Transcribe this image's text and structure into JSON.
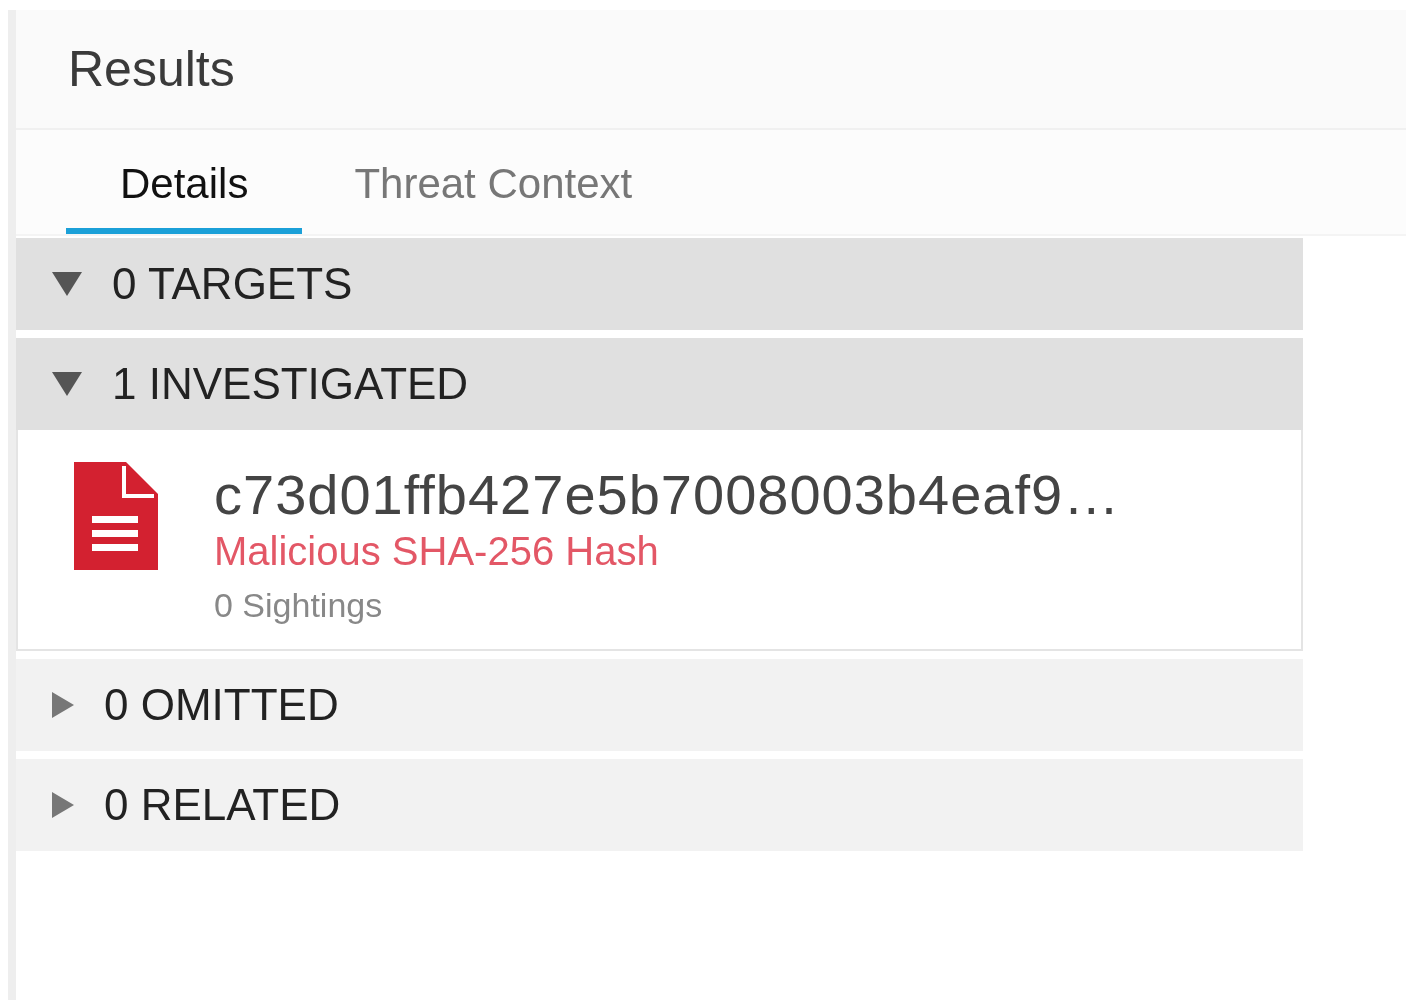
{
  "panel": {
    "title": "Results"
  },
  "tabs": [
    {
      "label": "Details",
      "selected": true
    },
    {
      "label": "Threat Context",
      "selected": false
    }
  ],
  "sections": [
    {
      "label": "0 TARGETS",
      "expanded": true
    },
    {
      "label": "1 INVESTIGATED",
      "expanded": true,
      "items": [
        {
          "hash": "c73d01ffb427e5b7008003b4eaf9…",
          "verdict": "Malicious SHA-256 Hash",
          "sightings": "0 Sightings"
        }
      ]
    },
    {
      "label": "0 OMITTED",
      "expanded": false
    },
    {
      "label": "0 RELATED",
      "expanded": false
    }
  ]
}
